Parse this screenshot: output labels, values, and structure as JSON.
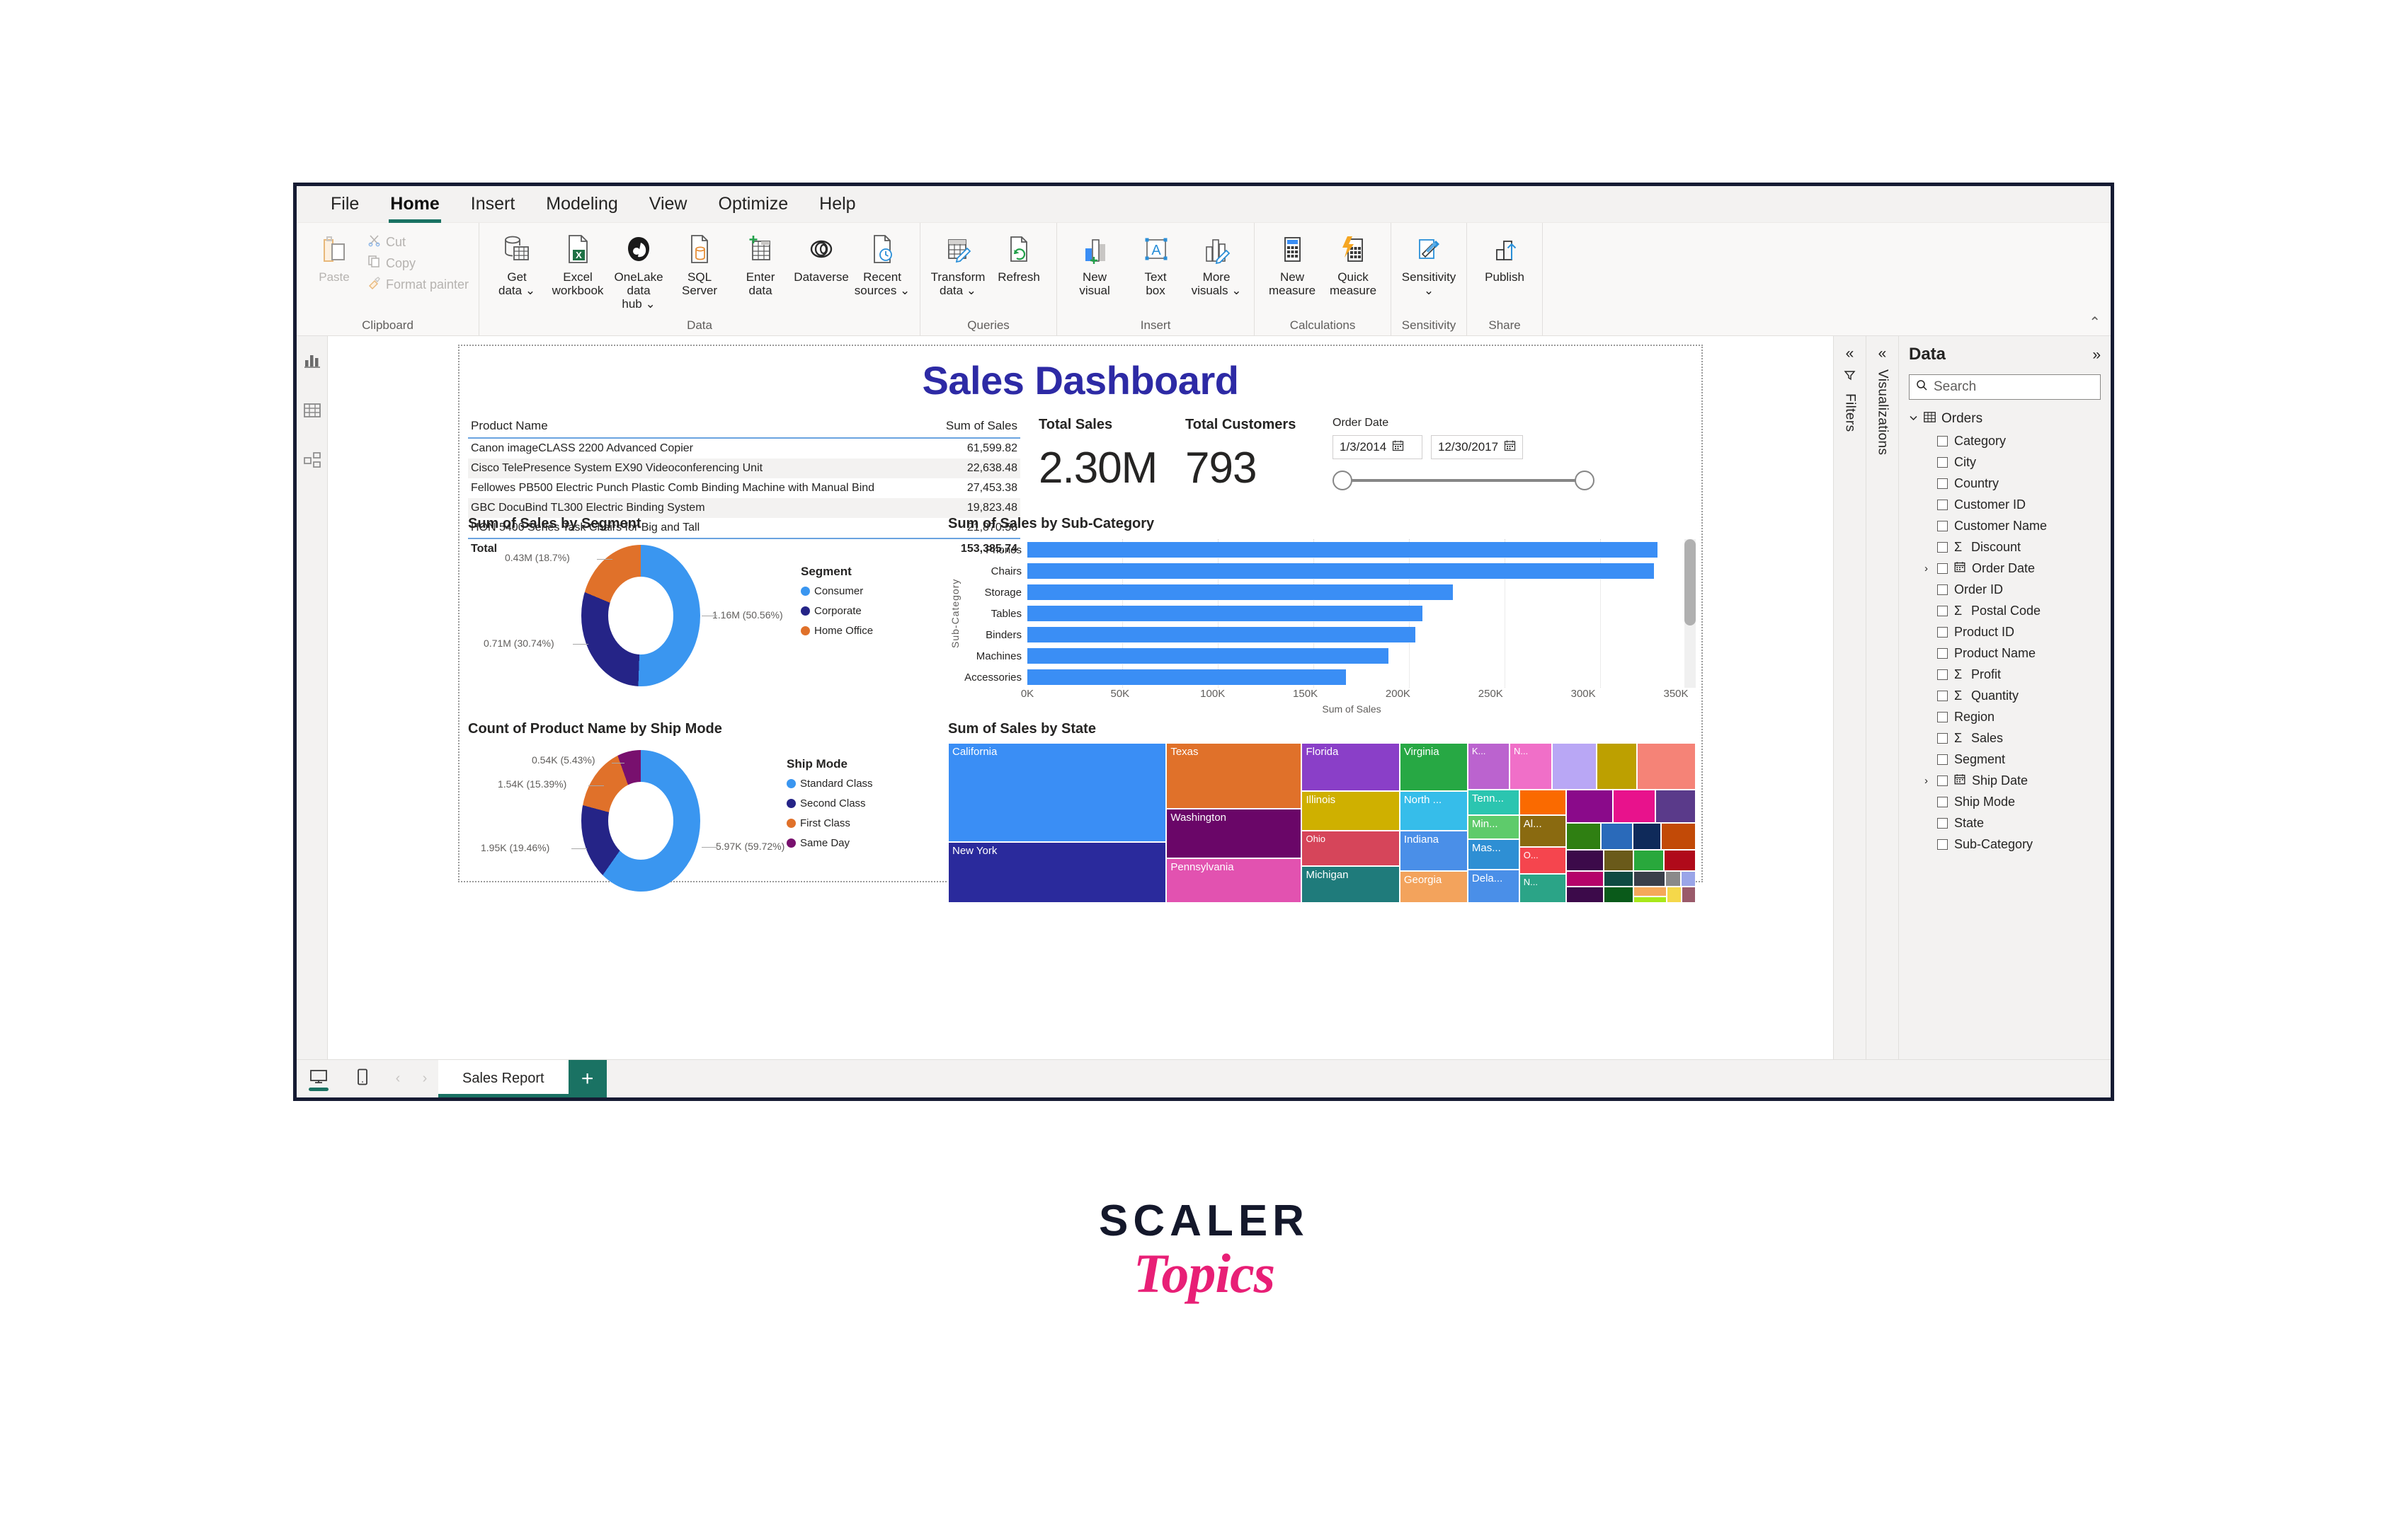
{
  "ribbon": {
    "tabs": [
      {
        "label": "File",
        "active": false
      },
      {
        "label": "Home",
        "active": true
      },
      {
        "label": "Insert",
        "active": false
      },
      {
        "label": "Modeling",
        "active": false
      },
      {
        "label": "View",
        "active": false
      },
      {
        "label": "Optimize",
        "active": false
      },
      {
        "label": "Help",
        "active": false
      }
    ],
    "groups": [
      {
        "name": "Clipboard",
        "label": "Clipboard",
        "paste_label": "Paste",
        "small_items": [
          {
            "label": "Cut",
            "icon": "scissors-icon"
          },
          {
            "label": "Copy",
            "icon": "copy-icon"
          },
          {
            "label": "Format painter",
            "icon": "format-painter-icon"
          }
        ]
      },
      {
        "name": "Data",
        "label": "Data",
        "items": [
          {
            "label": "Get\ndata ⌄",
            "icon": "get-data-icon"
          },
          {
            "label": "Excel\nworkbook",
            "icon": "excel-workbook-icon"
          },
          {
            "label": "OneLake data\nhub ⌄",
            "icon": "onelake-data-hub-icon"
          },
          {
            "label": "SQL\nServer",
            "icon": "sql-server-icon"
          },
          {
            "label": "Enter\ndata",
            "icon": "enter-data-icon"
          },
          {
            "label": "Dataverse",
            "icon": "dataverse-icon"
          },
          {
            "label": "Recent\nsources ⌄",
            "icon": "recent-sources-icon"
          }
        ]
      },
      {
        "name": "Queries",
        "label": "Queries",
        "items": [
          {
            "label": "Transform\ndata ⌄",
            "icon": "transform-data-icon"
          },
          {
            "label": "Refresh",
            "icon": "refresh-icon"
          }
        ]
      },
      {
        "name": "Insert",
        "label": "Insert",
        "items": [
          {
            "label": "New\nvisual",
            "icon": "new-visual-icon"
          },
          {
            "label": "Text\nbox",
            "icon": "text-box-icon"
          },
          {
            "label": "More\nvisuals ⌄",
            "icon": "more-visuals-icon"
          }
        ]
      },
      {
        "name": "Calculations",
        "label": "Calculations",
        "items": [
          {
            "label": "New\nmeasure",
            "icon": "new-measure-icon"
          },
          {
            "label": "Quick\nmeasure",
            "icon": "quick-measure-icon"
          }
        ]
      },
      {
        "name": "Sensitivity",
        "label": "Sensitivity",
        "items": [
          {
            "label": "Sensitivity\n⌄",
            "icon": "sensitivity-icon"
          }
        ]
      },
      {
        "name": "Share",
        "label": "Share",
        "items": [
          {
            "label": "Publish",
            "icon": "publish-icon"
          }
        ]
      }
    ],
    "collapse_glyph": "⌃"
  },
  "left_rail": [
    {
      "name": "report-view",
      "icon": "report-view-icon",
      "active": true
    },
    {
      "name": "data-view",
      "icon": "table-view-icon",
      "active": false
    },
    {
      "name": "model-view",
      "icon": "model-view-icon",
      "active": false
    }
  ],
  "report": {
    "title": "Sales Dashboard",
    "product_table": {
      "columns": [
        "Product Name",
        "Sum of Sales"
      ],
      "rows": [
        {
          "name": "Canon imageCLASS 2200 Advanced Copier",
          "sales": "61,599.82"
        },
        {
          "name": "Cisco TelePresence System EX90 Videoconferencing Unit",
          "sales": "22,638.48"
        },
        {
          "name": "Fellowes PB500 Electric Punch Plastic Comb Binding Machine with Manual Bind",
          "sales": "27,453.38"
        },
        {
          "name": "GBC DocuBind TL300 Electric Binding System",
          "sales": "19,823.48"
        },
        {
          "name": "HON 5400 Series Task Chairs for Big and Tall",
          "sales": "21,870.58"
        }
      ],
      "total_label": "Total",
      "total_value": "153,385.74"
    },
    "kpi_total_sales": {
      "label": "Total Sales",
      "value": "2.30M"
    },
    "kpi_total_customers": {
      "label": "Total Customers",
      "value": "793"
    },
    "date_slicer": {
      "title": "Order Date",
      "start": "1/3/2014",
      "end": "12/30/2017",
      "calendar_icon": "calendar-icon"
    },
    "chart_data": [
      {
        "type": "pie",
        "name": "segment-donut",
        "title": "Sum of Sales by Segment",
        "legend_title": "Segment",
        "legend_position": "right",
        "labels": [
          "Consumer",
          "Corporate",
          "Home Office"
        ],
        "values": [
          1.16,
          0.71,
          0.43
        ],
        "percents": [
          50.56,
          30.74,
          18.7
        ],
        "data_labels": [
          "1.16M (50.56%)",
          "0.71M (30.74%)",
          "0.43M (18.7%)"
        ],
        "colors": [
          "#3a96f0",
          "#252487",
          "#e0712a"
        ]
      },
      {
        "type": "pie",
        "name": "shipmode-donut",
        "title": "Count of Product Name by Ship Mode",
        "legend_title": "Ship Mode",
        "legend_position": "right",
        "labels": [
          "Standard Class",
          "Second Class",
          "First Class",
          "Same Day"
        ],
        "values": [
          5.97,
          1.95,
          1.54,
          0.54
        ],
        "percents": [
          59.72,
          19.46,
          15.39,
          5.43
        ],
        "data_labels": [
          "5.97K (59.72%)",
          "1.95K (19.46%)",
          "1.54K (15.39%)",
          "0.54K (5.43%)"
        ],
        "colors": [
          "#3a96f0",
          "#252487",
          "#e0712a",
          "#78106e"
        ]
      },
      {
        "type": "bar",
        "name": "subcategory-bar",
        "title": "Sum of Sales by Sub-Category",
        "orientation": "horizontal",
        "categories": [
          "Phones",
          "Chairs",
          "Storage",
          "Tables",
          "Binders",
          "Machines",
          "Accessories"
        ],
        "values": [
          330000,
          328000,
          223000,
          207000,
          203000,
          189000,
          167000
        ],
        "xlabel": "Sum of Sales",
        "ylabel": "Sub-Category",
        "xlim": [
          0,
          350000
        ],
        "xticks": [
          "0K",
          "50K",
          "100K",
          "150K",
          "200K",
          "250K",
          "300K",
          "350K"
        ],
        "grid": true,
        "bar_color": "#3a8ef5"
      },
      {
        "type": "treemap",
        "name": "state-treemap",
        "title": "Sum of Sales by State",
        "cells": [
          {
            "label": "California",
            "x": 0,
            "y": 0,
            "w": 29.2,
            "h": 62,
            "color": "#3a8ef5"
          },
          {
            "label": "New York",
            "x": 0,
            "y": 62,
            "w": 29.2,
            "h": 38,
            "color": "#2a2a9c"
          },
          {
            "label": "Texas",
            "x": 29.2,
            "y": 0,
            "w": 18.1,
            "h": 41,
            "color": "#e0712a"
          },
          {
            "label": "Washington",
            "x": 29.2,
            "y": 41,
            "w": 18.1,
            "h": 31,
            "color": "#6a0668"
          },
          {
            "label": "Pennsylvania",
            "x": 29.2,
            "y": 72,
            "w": 18.1,
            "h": 28,
            "color": "#e252b0"
          },
          {
            "label": "Florida",
            "x": 47.3,
            "y": 0,
            "w": 13.1,
            "h": 30,
            "color": "#8a3fc8"
          },
          {
            "label": "Illinois",
            "x": 47.3,
            "y": 30,
            "w": 13.1,
            "h": 25,
            "color": "#cfb000"
          },
          {
            "label": "Ohio",
            "x": 47.3,
            "y": 55,
            "w": 13.1,
            "h": 22,
            "color": "#d6455a"
          },
          {
            "label": "Michigan",
            "x": 47.3,
            "y": 77,
            "w": 13.1,
            "h": 23,
            "color": "#1f7b7b"
          },
          {
            "label": "Virginia",
            "x": 60.4,
            "y": 0,
            "w": 9.1,
            "h": 30,
            "color": "#27a844"
          },
          {
            "label": "North ...",
            "x": 60.4,
            "y": 30,
            "w": 9.1,
            "h": 25,
            "color": "#36bdea"
          },
          {
            "label": "Indiana",
            "x": 60.4,
            "y": 55,
            "w": 9.1,
            "h": 25,
            "color": "#4a8fe8"
          },
          {
            "label": "Georgia",
            "x": 60.4,
            "y": 80,
            "w": 9.1,
            "h": 20,
            "color": "#f3a35c"
          },
          {
            "label": "K...",
            "x": 69.5,
            "y": 0,
            "w": 5.6,
            "h": 29,
            "color": "#bb63cf"
          },
          {
            "label": "N...",
            "x": 75.1,
            "y": 0,
            "w": 5.7,
            "h": 29,
            "color": "#f06fc8"
          },
          {
            "label": "",
            "x": 80.8,
            "y": 0,
            "w": 5.9,
            "h": 29,
            "color": "#b9a7f5"
          },
          {
            "label": "",
            "x": 86.7,
            "y": 0,
            "w": 5.4,
            "h": 29,
            "color": "#bda000"
          },
          {
            "label": "",
            "x": 92.1,
            "y": 0,
            "w": 7.9,
            "h": 29,
            "color": "#f58377"
          },
          {
            "label": "Tenn...",
            "x": 69.5,
            "y": 29,
            "w": 6.9,
            "h": 16,
            "color": "#2bc5b0"
          },
          {
            "label": "Min...",
            "x": 69.5,
            "y": 45,
            "w": 6.9,
            "h": 15,
            "color": "#5ecb6b"
          },
          {
            "label": "Mas...",
            "x": 69.5,
            "y": 60,
            "w": 6.9,
            "h": 19,
            "color": "#2e8fd4"
          },
          {
            "label": "Dela...",
            "x": 69.5,
            "y": 79,
            "w": 6.9,
            "h": 21,
            "color": "#4a8fe8"
          },
          {
            "label": "Al...",
            "x": 76.4,
            "y": 45,
            "w": 6.3,
            "h": 20,
            "color": "#8a6a10"
          },
          {
            "label": "O...",
            "x": 76.4,
            "y": 65,
            "w": 6.3,
            "h": 17,
            "color": "#f5454e"
          },
          {
            "label": "N...",
            "x": 76.4,
            "y": 82,
            "w": 6.3,
            "h": 18,
            "color": "#2ba487"
          },
          {
            "label": "",
            "x": 76.4,
            "y": 29,
            "w": 6.3,
            "h": 16,
            "color": "#fa6a00"
          },
          {
            "label": "",
            "x": 82.7,
            "y": 29,
            "w": 6.2,
            "h": 21,
            "color": "#8a0a8a"
          },
          {
            "label": "",
            "x": 88.9,
            "y": 29,
            "w": 5.7,
            "h": 21,
            "color": "#e8128c"
          },
          {
            "label": "",
            "x": 94.6,
            "y": 29,
            "w": 5.4,
            "h": 21,
            "color": "#5a3a8a"
          },
          {
            "label": "",
            "x": 82.7,
            "y": 50,
            "w": 4.6,
            "h": 17,
            "color": "#2f7f12"
          },
          {
            "label": "",
            "x": 87.3,
            "y": 50,
            "w": 4.3,
            "h": 17,
            "color": "#2a6aba"
          },
          {
            "label": "",
            "x": 91.6,
            "y": 50,
            "w": 3.8,
            "h": 17,
            "color": "#0f2a5a"
          },
          {
            "label": "",
            "x": 95.4,
            "y": 50,
            "w": 4.6,
            "h": 17,
            "color": "#c24a07"
          },
          {
            "label": "",
            "x": 82.7,
            "y": 67,
            "w": 5.0,
            "h": 13,
            "color": "#3c0a4a"
          },
          {
            "label": "",
            "x": 87.7,
            "y": 67,
            "w": 4.0,
            "h": 13,
            "color": "#6a5a1a"
          },
          {
            "label": "",
            "x": 91.7,
            "y": 67,
            "w": 4.0,
            "h": 13,
            "color": "#29a83c"
          },
          {
            "label": "",
            "x": 95.7,
            "y": 67,
            "w": 4.3,
            "h": 13,
            "color": "#b00a1a"
          },
          {
            "label": "",
            "x": 82.7,
            "y": 80,
            "w": 5.0,
            "h": 10,
            "color": "#b5046a"
          },
          {
            "label": "",
            "x": 82.7,
            "y": 90,
            "w": 5.0,
            "h": 10,
            "color": "#3c0a4a"
          },
          {
            "label": "",
            "x": 87.7,
            "y": 80,
            "w": 4.0,
            "h": 10,
            "color": "#0f4a42"
          },
          {
            "label": "",
            "x": 91.7,
            "y": 80,
            "w": 4.2,
            "h": 10,
            "color": "#3a3f4a"
          },
          {
            "label": "",
            "x": 95.9,
            "y": 80,
            "w": 2.1,
            "h": 10,
            "color": "#8a8a8a"
          },
          {
            "label": "",
            "x": 98.0,
            "y": 80,
            "w": 2.0,
            "h": 10,
            "color": "#9aa5e8"
          },
          {
            "label": "",
            "x": 87.7,
            "y": 90,
            "w": 4.0,
            "h": 10,
            "color": "#0a5a1a"
          },
          {
            "label": "",
            "x": 91.7,
            "y": 90,
            "w": 4.4,
            "h": 6,
            "color": "#f5a85a"
          },
          {
            "label": "",
            "x": 91.7,
            "y": 96,
            "w": 4.4,
            "h": 4,
            "color": "#a8e81a"
          },
          {
            "label": "",
            "x": 96.1,
            "y": 90,
            "w": 2.0,
            "h": 10,
            "color": "#f5d84a"
          },
          {
            "label": "",
            "x": 98.1,
            "y": 90,
            "w": 1.9,
            "h": 10,
            "color": "#9a5a6a"
          }
        ]
      }
    ]
  },
  "side_panes": [
    {
      "name": "filters",
      "label": "Filters",
      "icon": "filter-icon",
      "chevron": "«"
    },
    {
      "name": "visualizations",
      "label": "Visualizations",
      "icon": "",
      "chevron": "«"
    }
  ],
  "data_pane": {
    "title": "Data",
    "expand_glyph": "»",
    "search_placeholder": "Search",
    "search_icon": "search-icon",
    "table": {
      "name": "Orders",
      "expanded": true,
      "icon": "table-icon",
      "chevron": "⌄"
    },
    "fields": [
      {
        "name": "Category",
        "type": "text",
        "expandable": false
      },
      {
        "name": "City",
        "type": "text",
        "expandable": false
      },
      {
        "name": "Country",
        "type": "text",
        "expandable": false
      },
      {
        "name": "Customer ID",
        "type": "text",
        "expandable": false
      },
      {
        "name": "Customer Name",
        "type": "text",
        "expandable": false
      },
      {
        "name": "Discount",
        "type": "numeric",
        "expandable": false
      },
      {
        "name": "Order Date",
        "type": "date",
        "expandable": true
      },
      {
        "name": "Order ID",
        "type": "text",
        "expandable": false
      },
      {
        "name": "Postal Code",
        "type": "numeric",
        "expandable": false
      },
      {
        "name": "Product ID",
        "type": "text",
        "expandable": false
      },
      {
        "name": "Product Name",
        "type": "text",
        "expandable": false
      },
      {
        "name": "Profit",
        "type": "numeric",
        "expandable": false
      },
      {
        "name": "Quantity",
        "type": "numeric",
        "expandable": false
      },
      {
        "name": "Region",
        "type": "text",
        "expandable": false
      },
      {
        "name": "Sales",
        "type": "numeric",
        "expandable": false
      },
      {
        "name": "Segment",
        "type": "text",
        "expandable": false
      },
      {
        "name": "Ship Date",
        "type": "date",
        "expandable": true
      },
      {
        "name": "Ship Mode",
        "type": "text",
        "expandable": false
      },
      {
        "name": "State",
        "type": "text",
        "expandable": false
      },
      {
        "name": "Sub-Category",
        "type": "text",
        "expandable": false
      }
    ]
  },
  "bottom_bar": {
    "desktop_icon": "desktop-view-icon",
    "mobile_icon": "mobile-view-icon",
    "prev_glyph": "‹",
    "next_glyph": "›",
    "pages": [
      {
        "label": "Sales Report",
        "active": true
      }
    ],
    "add_page_glyph": "+"
  },
  "branding": {
    "word_mark": "SCALER",
    "script_mark": "Topics",
    "word_color": "#14182b",
    "script_color": "#e81f76"
  }
}
